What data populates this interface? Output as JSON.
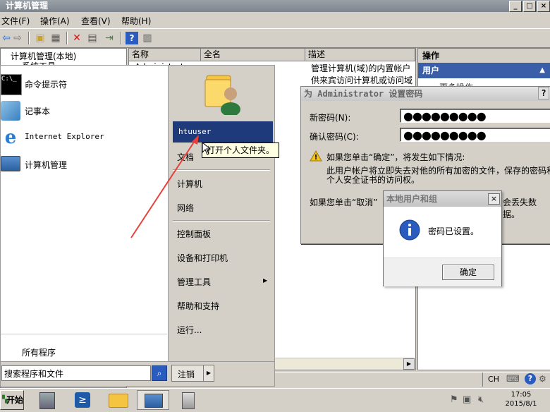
{
  "mmc": {
    "title": "计算机管理",
    "menu": [
      "文件(F)",
      "操作(A)",
      "查看(V)",
      "帮助(H)"
    ],
    "tree": [
      "计算机管理(本地)",
      "系统工具"
    ],
    "columns": [
      "名称",
      "全名",
      "描述"
    ],
    "rows": [
      {
        "name": "Administrator",
        "fullname": "",
        "desc": "管理计算机(域)的内置帐户"
      },
      {
        "name": "",
        "fullname": "",
        "desc": "供来宾访问计算机或访问域"
      }
    ],
    "actions_title": "操作",
    "actions_section": "用户",
    "actions_item": "更多操作",
    "status_ime": "CH"
  },
  "pwdialog": {
    "title": "为 Administrator 设置密码",
    "help": "?",
    "new_label": "新密码(N):",
    "confirm_label": "确认密码(C):",
    "new_value": "●●●●●●●●●",
    "confirm_value": "●●●●●●●●●",
    "warn_line1": "如果您单击“确定”，将发生如下情况:",
    "warn_line2": "此用户帐户将立即失去对他的所有加密的文件，保存的密码和",
    "warn_line3": "个人安全证书的访问权。",
    "cancel_line_a": "如果您单击“取消”",
    "cancel_line_b": "会丢失数据。"
  },
  "msgbox": {
    "title": "本地用户和组",
    "close": "×",
    "message": "密码已设置。",
    "ok": "确定",
    "colors": {
      "info_icon": "#2a5bbf"
    }
  },
  "startmenu": {
    "programs": [
      "命令提示符",
      "记事本",
      "Internet Explorer",
      "计算机管理"
    ],
    "all_programs": "所有程序",
    "search_placeholder": "搜索程序和文件",
    "user": "htuuser",
    "tooltip": "打开个人文件夹。",
    "links": [
      "文档",
      "计算机",
      "网络",
      "控制面板",
      "设备和打印机",
      "管理工具",
      "帮助和支持",
      "运行..."
    ],
    "shutdown": "注销",
    "colors": {
      "highlight": "#1e3a7a",
      "arrow": "#e8413a"
    }
  },
  "taskbar": {
    "start": "开始",
    "time": "17:05",
    "date": "2015/8/1"
  }
}
